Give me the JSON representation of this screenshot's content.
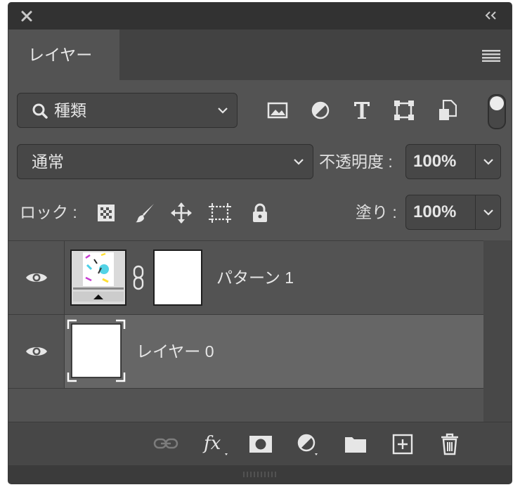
{
  "panel": {
    "tab_label": "レイヤー"
  },
  "filter": {
    "kind_label": "種類"
  },
  "blend": {
    "mode": "通常",
    "opacity_label": "不透明度 :",
    "opacity_value": "100%"
  },
  "lock": {
    "label": "ロック :",
    "fill_label": "塗り :",
    "fill_value": "100%"
  },
  "layers": [
    {
      "name": "パターン 1",
      "visible": true,
      "selected": false
    },
    {
      "name": "レイヤー 0",
      "visible": true,
      "selected": true
    }
  ],
  "colors": {
    "panel_bg": "#535353",
    "selected_row": "#666666",
    "text": "#e6e6e6"
  }
}
